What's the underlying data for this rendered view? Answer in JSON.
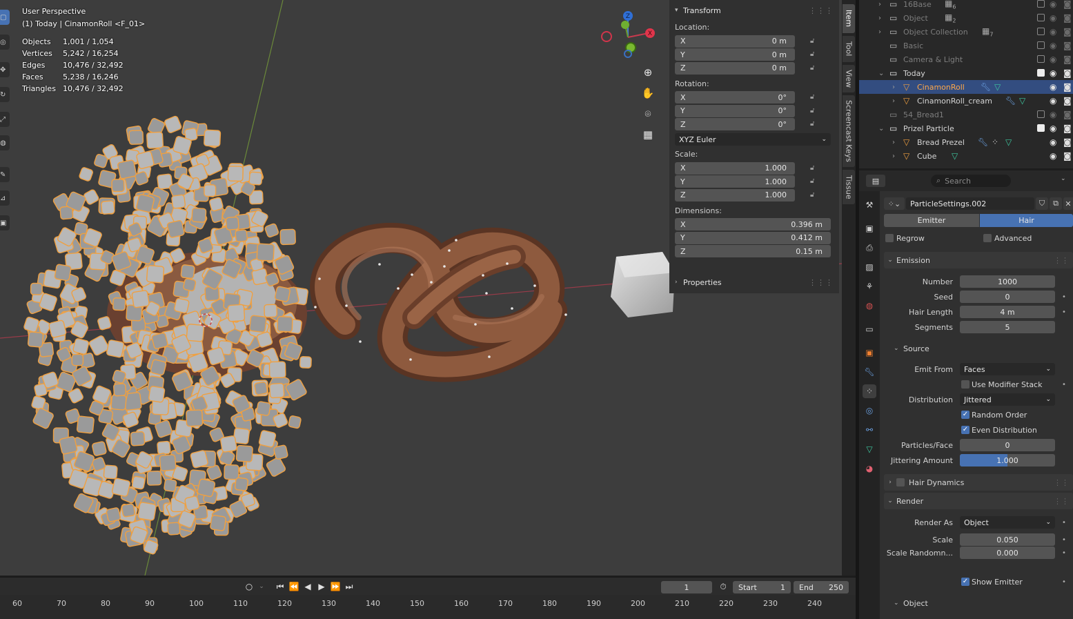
{
  "viewport": {
    "perspective": "User Perspective",
    "context": "(1) Today | CinamonRoll <F_01>",
    "stats": [
      {
        "key": "Objects",
        "value": "1,001 / 1,054"
      },
      {
        "key": "Vertices",
        "value": "5,242 / 16,254"
      },
      {
        "key": "Edges",
        "value": "10,476 / 32,492"
      },
      {
        "key": "Faces",
        "value": "5,238 / 16,246"
      },
      {
        "key": "Triangles",
        "value": "10,476 / 32,492"
      }
    ],
    "gizmo": {
      "x": "X",
      "y": "Y",
      "z": "Z"
    }
  },
  "npanel": {
    "transform_label": "Transform",
    "location_label": "Location:",
    "location": [
      {
        "axis": "X",
        "value": "0 m"
      },
      {
        "axis": "Y",
        "value": "0 m"
      },
      {
        "axis": "Z",
        "value": "0 m"
      }
    ],
    "rotation_label": "Rotation:",
    "rotation": [
      {
        "axis": "X",
        "value": "0°"
      },
      {
        "axis": "Y",
        "value": "0°"
      },
      {
        "axis": "Z",
        "value": "0°"
      }
    ],
    "rotation_mode": "XYZ Euler",
    "scale_label": "Scale:",
    "scale": [
      {
        "axis": "X",
        "value": "1.000"
      },
      {
        "axis": "Y",
        "value": "1.000"
      },
      {
        "axis": "Z",
        "value": "1.000"
      }
    ],
    "dimensions_label": "Dimensions:",
    "dimensions": [
      {
        "axis": "X",
        "value": "0.396 m"
      },
      {
        "axis": "Y",
        "value": "0.412 m"
      },
      {
        "axis": "Z",
        "value": "0.15 m"
      }
    ],
    "properties_label": "Properties"
  },
  "vtabs": [
    "Item",
    "Tool",
    "View",
    "Screencast Keys",
    "Tissue"
  ],
  "timeline": {
    "current_frame": "1",
    "start_label": "Start",
    "start": "1",
    "end_label": "End",
    "end": "250",
    "ticks": [
      "60",
      "70",
      "80",
      "90",
      "100",
      "110",
      "120",
      "130",
      "140",
      "150",
      "160",
      "170",
      "180",
      "190",
      "200",
      "210",
      "220",
      "230",
      "240"
    ]
  },
  "outliner": {
    "rows": [
      {
        "label": "16Base",
        "badge": "6"
      },
      {
        "label": "Object",
        "badge": "2"
      },
      {
        "label": "Object Collection",
        "badge": "7"
      },
      {
        "label": "Basic"
      },
      {
        "label": "Camera & Light"
      },
      {
        "label": "Today"
      },
      {
        "label": "CinamonRoll"
      },
      {
        "label": "CinamonRoll_cream"
      },
      {
        "label": "54_Bread1"
      },
      {
        "label": "Prizel Particle"
      },
      {
        "label": "Bread Prezel"
      },
      {
        "label": "Cube"
      }
    ]
  },
  "properties": {
    "search_placeholder": "Search",
    "settings_name": "ParticleSettings.002",
    "type_emitter": "Emitter",
    "type_hair": "Hair",
    "regrow": "Regrow",
    "advanced": "Advanced",
    "emission": {
      "title": "Emission",
      "number_label": "Number",
      "number": "1000",
      "seed_label": "Seed",
      "seed": "0",
      "hair_length_label": "Hair Length",
      "hair_length": "4 m",
      "segments_label": "Segments",
      "segments": "5"
    },
    "source": {
      "title": "Source",
      "emit_from_label": "Emit From",
      "emit_from": "Faces",
      "use_modifier_stack": "Use Modifier Stack",
      "distribution_label": "Distribution",
      "distribution": "Jittered",
      "random_order": "Random Order",
      "even_distribution": "Even Distribution",
      "particles_face_label": "Particles/Face",
      "particles_face": "0",
      "jittering_label": "Jittering Amount",
      "jittering": "1.000",
      "jittering_fraction": 0.5
    },
    "hair_dynamics": "Hair Dynamics",
    "render": {
      "title": "Render",
      "render_as_label": "Render As",
      "render_as": "Object",
      "scale_label": "Scale",
      "scale": "0.050",
      "scale_random_label": "Scale Randomn...",
      "scale_random": "0.000",
      "show_emitter": "Show Emitter"
    },
    "object_section": "Object"
  },
  "colors": {
    "accent": "#4772b3",
    "selected_outline": "#f0a040",
    "active_object": "#ffa84a",
    "viewport_bg": "#3d3d3d"
  }
}
